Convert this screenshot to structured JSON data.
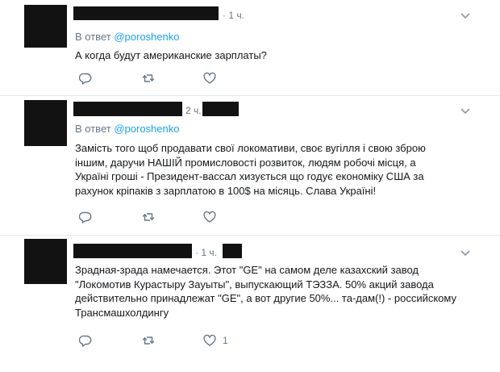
{
  "tweets": [
    {
      "time": "· 1 ч.",
      "reply_prefix": "В ответ",
      "reply_handle": "@poroshenko",
      "lines": [
        "А когда будут американские зарплаты?"
      ],
      "like_count": ""
    },
    {
      "time": "2 ч.",
      "reply_prefix": "В ответ",
      "reply_handle": "@poroshenko",
      "lines": [
        "Замість того щоб продавати свої локомативи, своє вугілля і свою зброю",
        "іншим, даручи НАШІЙ промисловості розвиток, людям робочі місця, а",
        "Україні гроші - Президент-вассал хизується що годує економіку США за",
        "рахунок кріпаків з зарплатою в 100$ на місяць. Слава Україні!"
      ],
      "like_count": ""
    },
    {
      "time": "· 1 ч.",
      "reply_prefix": "",
      "reply_handle": "",
      "lines": [
        "Зрадная-зрада намечается. Этот \"GE\" на самом деле казахский завод",
        "\"Локомотив Курастыру Зауыты\", выпускающий ТЭЗЗА. 50% акций завода",
        "действительно принадлежат \"GE\", а вот другие 50%... та-дам(!) - российскому",
        "Трансмашхолдингу"
      ],
      "like_count": "1"
    }
  ],
  "icons": {
    "reply": "reply-icon",
    "retweet": "retweet-icon",
    "like": "like-icon",
    "more": "chevron-down-icon"
  },
  "colors": {
    "link": "#1da1f2",
    "muted": "#657786",
    "text": "#14171a",
    "separator": "#e1e8ed"
  }
}
